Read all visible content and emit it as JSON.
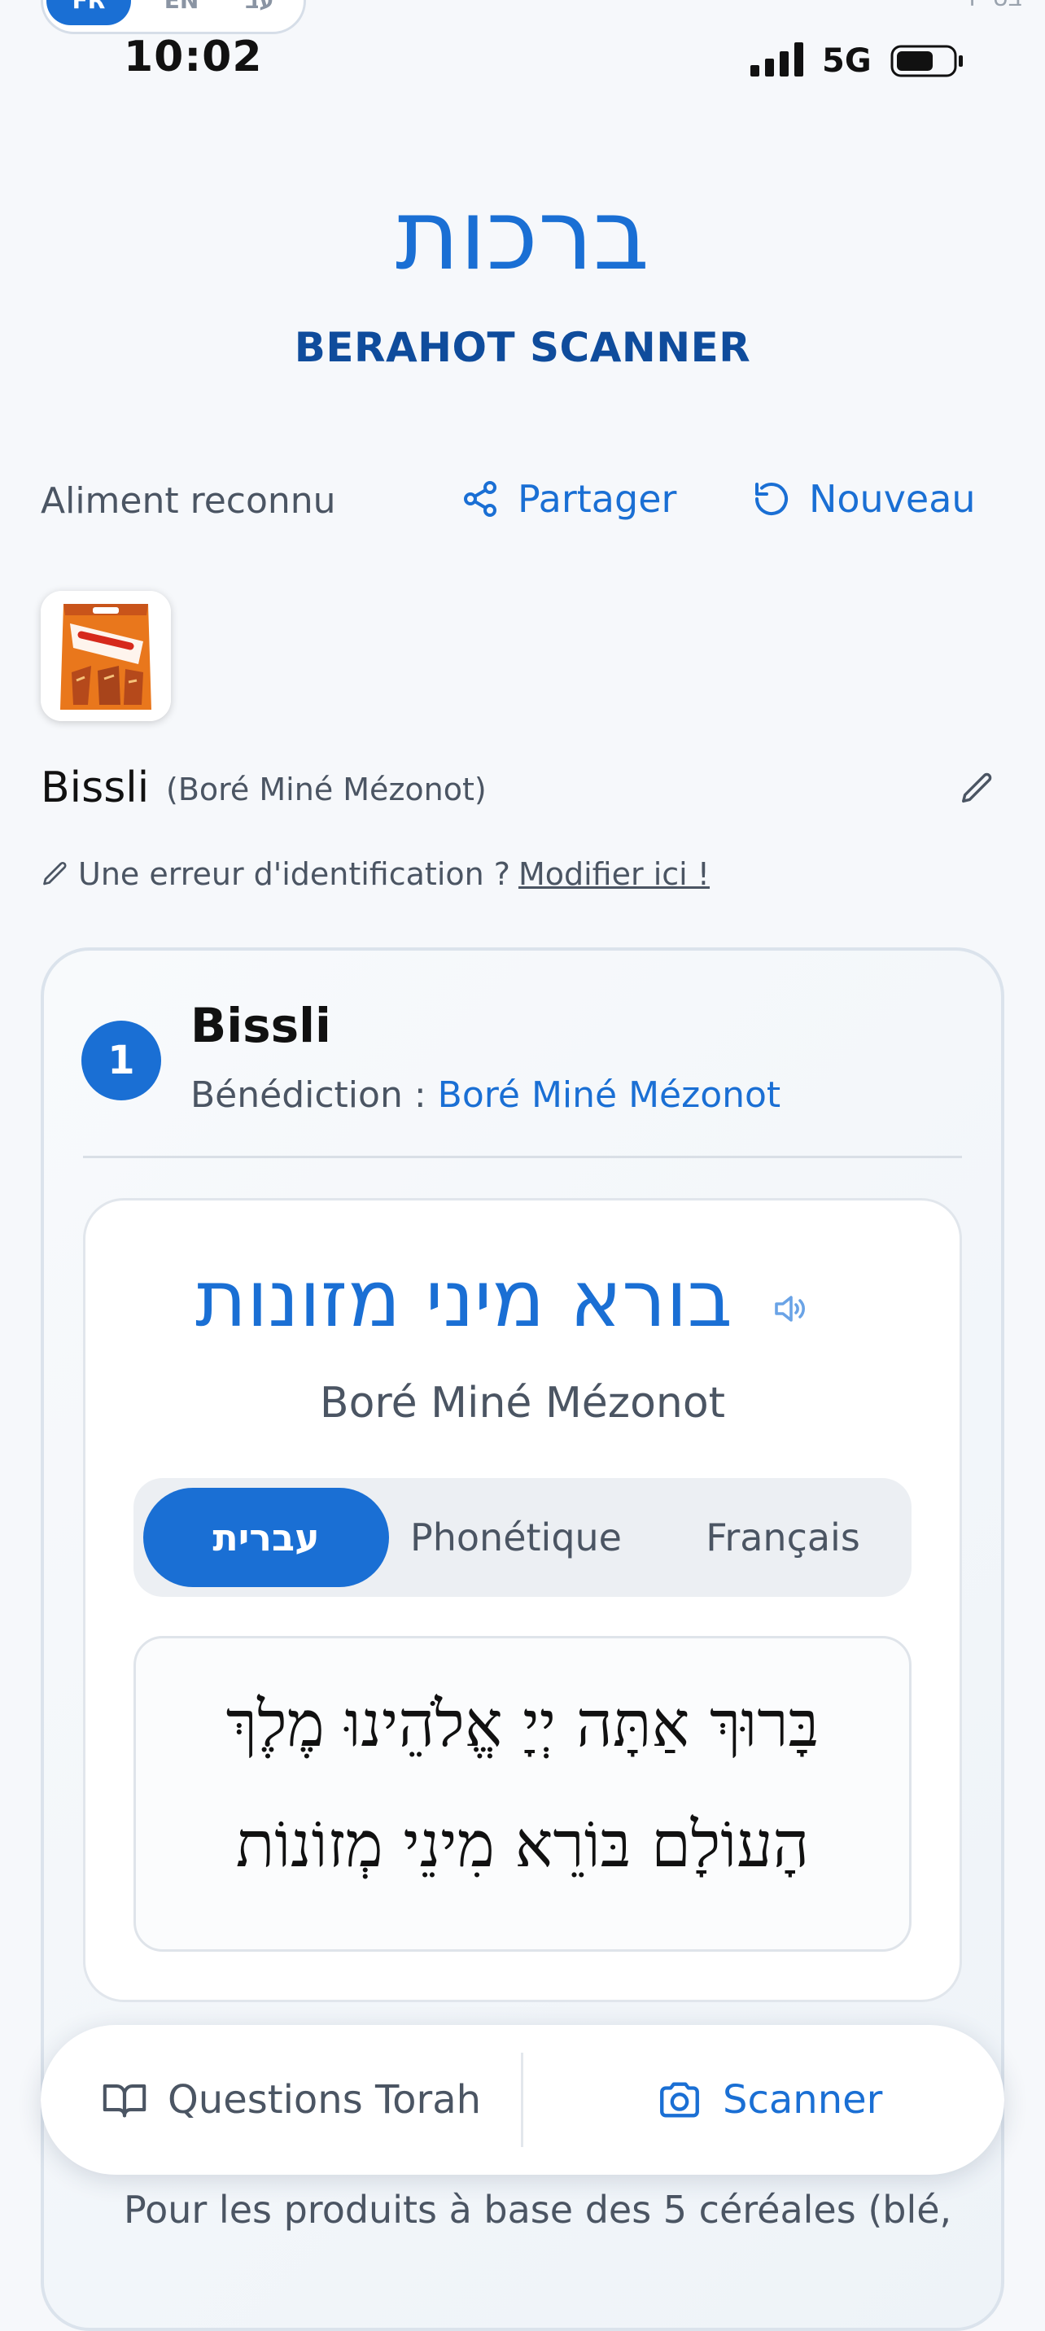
{
  "language_switcher": {
    "options": [
      "FR",
      "EN",
      "עב"
    ],
    "active": "FR"
  },
  "corner_text": "בס״ד",
  "status_bar": {
    "time": "10:02",
    "network": "5G"
  },
  "header": {
    "hebrew_title": "ברכות",
    "subtitle": "BERAHOT SCANNER"
  },
  "result_bar": {
    "label": "Aliment reconnu",
    "share_label": "Partager",
    "new_label": "Nouveau"
  },
  "product": {
    "thumbnail_icon": "bissli-package-image",
    "name": "Bissli",
    "bracha_hint": "(Boré Miné Mézonot)"
  },
  "error_notice": {
    "text": "Une erreur d'identification ?",
    "link": "Modifier ici !"
  },
  "item": {
    "number": "1",
    "title": "Bissli",
    "bracha_prefix": "Bénédiction :",
    "bracha_name": "Boré Miné Mézonot",
    "bracha_hebrew": "בורא מיני מזונות",
    "bracha_transliteration": "Boré Miné Mézonot",
    "tabs": [
      "עברית",
      "Phonétique",
      "Français"
    ],
    "active_tab": "עברית",
    "text_lines": [
      "בָּרוּךְ אַתָּה יְיָ אֱלֹהֵינוּ מֶלֶךְ",
      "הָעוֹלָם בּוֹרֵא מִינֵי מְזוֹנוֹת"
    ],
    "explanation": "Pour les produits à base des 5 céréales (blé,"
  },
  "bottom_nav": {
    "questions_label": "Questions Torah",
    "scanner_label": "Scanner"
  },
  "colors": {
    "accent": "#1a6fd4",
    "subtitle": "#0f4c9c",
    "muted": "#4b5563"
  }
}
